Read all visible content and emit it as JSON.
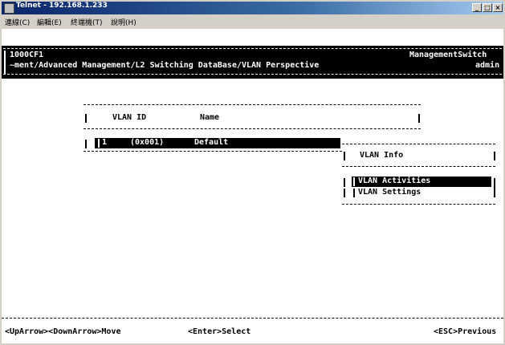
{
  "window": {
    "title": "Telnet - 192.168.1.233"
  },
  "menu": [
    "連線(C)",
    "編輯(E)",
    "終端機(T)",
    "說明(H)"
  ],
  "header": {
    "device": "1000CF1",
    "path": "~ment/Advanced Management/L2 Switching DataBase/VLAN Perspective",
    "product": "ManagementSwitch",
    "user": "admin"
  },
  "vlan_table": {
    "col_id": "VLAN ID",
    "col_name": "Name",
    "rows": [
      {
        "index": "1",
        "id": "(0x001)",
        "name": "Default"
      }
    ]
  },
  "vlan_info": {
    "title": "VLAN Info",
    "items": [
      "VLAN Activities",
      "VLAN Settings"
    ]
  },
  "footer": {
    "nav": "<UpArrow><DownArrow>Move",
    "select": "<Enter>Select",
    "previous": "<ESC>Previous"
  }
}
